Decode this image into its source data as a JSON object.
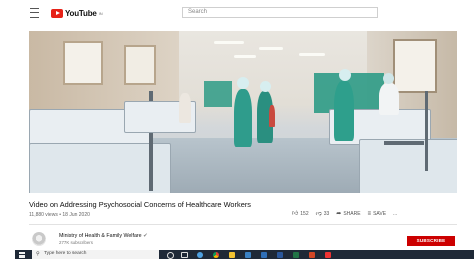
{
  "browser": {
    "menu_icon": "hamburger-icon",
    "logo_text": "YouTube",
    "logo_sup": "IN",
    "search_placeholder": "Search"
  },
  "video": {
    "title": "Video on Addressing Psychosocial Concerns of Healthcare Workers",
    "views": "11,880 views",
    "separator": "•",
    "date": "18 Jun 2020",
    "likes": "152",
    "dislikes": "33",
    "share_label": "SHARE",
    "save_label": "SAVE",
    "more_label": "..."
  },
  "channel": {
    "name": "Ministry of Health & Family Welfare",
    "subscribers": "277K subscribers",
    "subscribe_label": "SUBSCRIBE"
  },
  "taskbar": {
    "search_placeholder": "Type here to search",
    "icons": [
      "start-icon",
      "search-icon",
      "cortana-icon",
      "task-view-icon",
      "edge-icon",
      "chrome-icon",
      "explorer-icon",
      "store-icon",
      "mail-icon",
      "word-icon",
      "excel-icon",
      "powerpoint-icon"
    ]
  },
  "colors": {
    "brand_red": "#e62117",
    "subscribe_red": "#cc0000",
    "taskbar": "#1f2937",
    "scrubs_green": "#2e9b86"
  }
}
